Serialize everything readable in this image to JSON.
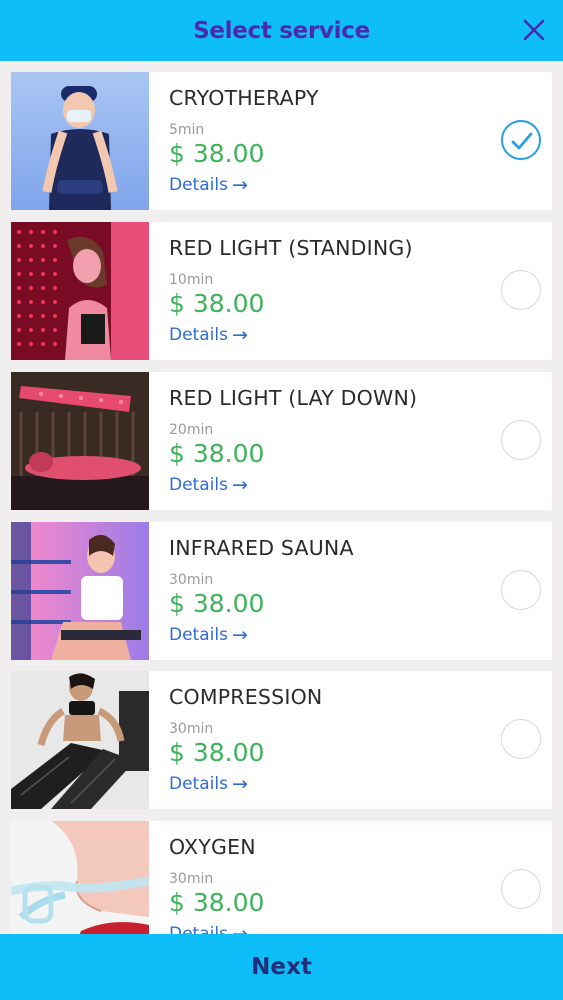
{
  "header": {
    "title": "Select service"
  },
  "services": [
    {
      "name": "CRYOTHERAPY",
      "duration": "5min",
      "price": "$ 38.00",
      "details": "Details",
      "selected": true,
      "image": "cryotherapy-photo"
    },
    {
      "name": "RED LIGHT (STANDING)",
      "duration": "10min",
      "price": "$ 38.00",
      "details": "Details",
      "selected": false,
      "image": "red-light-standing-photo"
    },
    {
      "name": "RED LIGHT (LAY DOWN)",
      "duration": "20min",
      "price": "$ 38.00",
      "details": "Details",
      "selected": false,
      "image": "red-light-lay-down-photo"
    },
    {
      "name": "INFRARED SAUNA",
      "duration": "30min",
      "price": "$ 38.00",
      "details": "Details",
      "selected": false,
      "image": "infrared-sauna-photo"
    },
    {
      "name": "COMPRESSION",
      "duration": "30min",
      "price": "$ 38.00",
      "details": "Details",
      "selected": false,
      "image": "compression-photo"
    },
    {
      "name": "OXYGEN",
      "duration": "30min",
      "price": "$ 38.00",
      "details": "Details",
      "selected": false,
      "image": "oxygen-photo"
    }
  ],
  "footer": {
    "next_label": "Next"
  },
  "colors": {
    "header_bg": "#0ebef9",
    "price": "#3db35a",
    "link": "#2f6cd6",
    "title": "#4a2bb0",
    "check": "#2a9fdc"
  }
}
